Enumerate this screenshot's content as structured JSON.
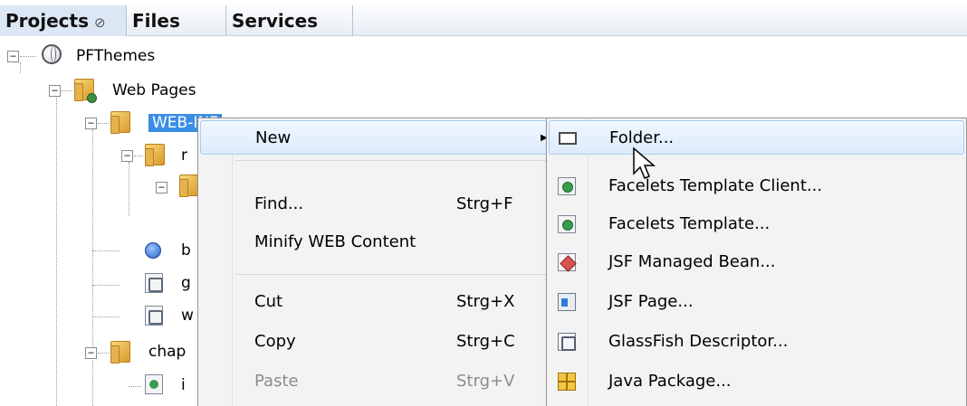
{
  "tabs": [
    {
      "label": "Projects",
      "close": "⊘",
      "active": true
    },
    {
      "label": "Files",
      "active": false
    },
    {
      "label": "Services",
      "active": false
    }
  ],
  "tree": {
    "project": "PFThemes",
    "web_pages": "Web Pages",
    "web_inf": "WEB-INF",
    "child_r": "r",
    "child_b": "b",
    "child_g": "g",
    "child_w": "w",
    "chapter": "chap",
    "child_i": "i"
  },
  "context_menu": {
    "items": [
      {
        "label": "New",
        "shortcut": "",
        "submenu": true
      },
      {
        "label": "Find...",
        "shortcut": "Strg+F"
      },
      {
        "label": "Minify WEB Content",
        "shortcut": ""
      },
      {
        "label": "Cut",
        "shortcut": "Strg+X"
      },
      {
        "label": "Copy",
        "shortcut": "Strg+C"
      },
      {
        "label": "Paste",
        "shortcut": "Strg+V",
        "disabled": true
      }
    ]
  },
  "new_submenu": {
    "items": [
      {
        "label": "Folder...",
        "icon": "folder-icon"
      },
      {
        "label": "Facelets Template Client...",
        "icon": "facelets-template-client-icon"
      },
      {
        "label": "Facelets Template...",
        "icon": "facelets-template-icon"
      },
      {
        "label": "JSF Managed Bean...",
        "icon": "jsf-managed-bean-icon"
      },
      {
        "label": "JSF Page...",
        "icon": "jsf-page-icon"
      },
      {
        "label": "GlassFish Descriptor...",
        "icon": "glassfish-descriptor-icon"
      },
      {
        "label": "Java Package...",
        "icon": "java-package-icon"
      }
    ]
  },
  "colors": {
    "selection": "#3a8ee6",
    "menu_bg": "#f3f3f3",
    "hover_border": "#a8cdf3"
  }
}
